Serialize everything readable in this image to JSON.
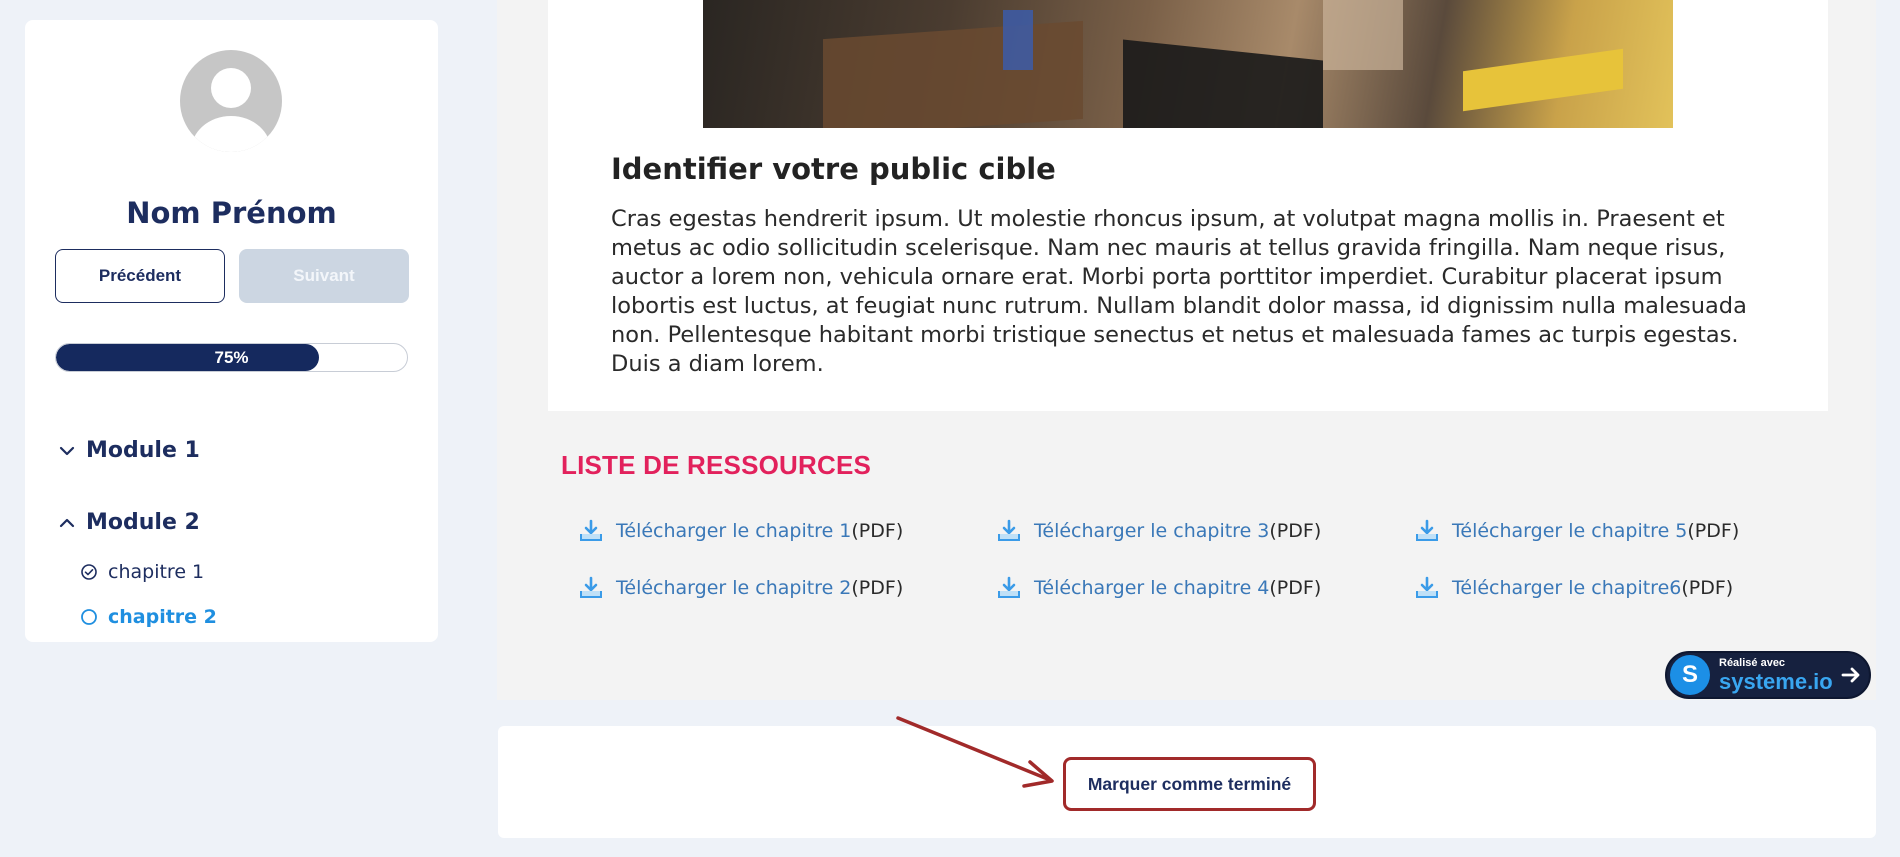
{
  "sidebar": {
    "user_name": "Nom Prénom",
    "prev_label": "Précédent",
    "next_label": "Suivant",
    "progress_label": "75%",
    "progress_value": 0.75,
    "modules": [
      {
        "label": "Module 1",
        "expanded": false
      },
      {
        "label": "Module 2",
        "expanded": true,
        "chapters": [
          {
            "label": "chapitre 1",
            "status": "done"
          },
          {
            "label": "chapitre 2",
            "status": "current"
          }
        ]
      }
    ]
  },
  "content": {
    "title": "Identifier votre public cible",
    "text": "Cras egestas hendrerit ipsum. Ut molestie rhoncus ipsum, at volutpat magna mollis in. Praesent et metus ac odio sollicitudin scelerisque. Nam nec mauris at tellus gravida fringilla. Nam neque risus, auctor a lorem non, vehicula ornare erat. Morbi porta porttitor imperdiet. Curabitur placerat ipsum lobortis est luctus, at feugiat nunc rutrum. Nullam blandit dolor massa, id dignissim nulla malesuada non. Pellentesque habitant morbi tristique senectus et netus et malesuada fames ac turpis egestas. Duis a diam lorem."
  },
  "resources": {
    "title": "LISTE DE RESSOURCES",
    "items": [
      {
        "link": "Télécharger le chapitre 1",
        "suffix": "(PDF)"
      },
      {
        "link": "Télécharger le chapitre 3",
        "suffix": "(PDF)"
      },
      {
        "link": "Télécharger le chapitre 5",
        "suffix": " (PDF)"
      },
      {
        "link": "Télécharger le chapitre 2",
        "suffix": " (PDF)"
      },
      {
        "link": "Télécharger le chapitre 4",
        "suffix": " (PDF)"
      },
      {
        "link": "Télécharger le chapitre6",
        "suffix": " (PDF)"
      }
    ]
  },
  "badge": {
    "line1": "Réalisé avec",
    "line2": "systeme.io",
    "logo_letter": "S"
  },
  "footer": {
    "complete_label": "Marquer comme terminé"
  },
  "colors": {
    "navy": "#1d2d5f",
    "accent_blue": "#1f8fe0",
    "resource_title": "#e2215c",
    "annotation": "#a12a2a"
  }
}
